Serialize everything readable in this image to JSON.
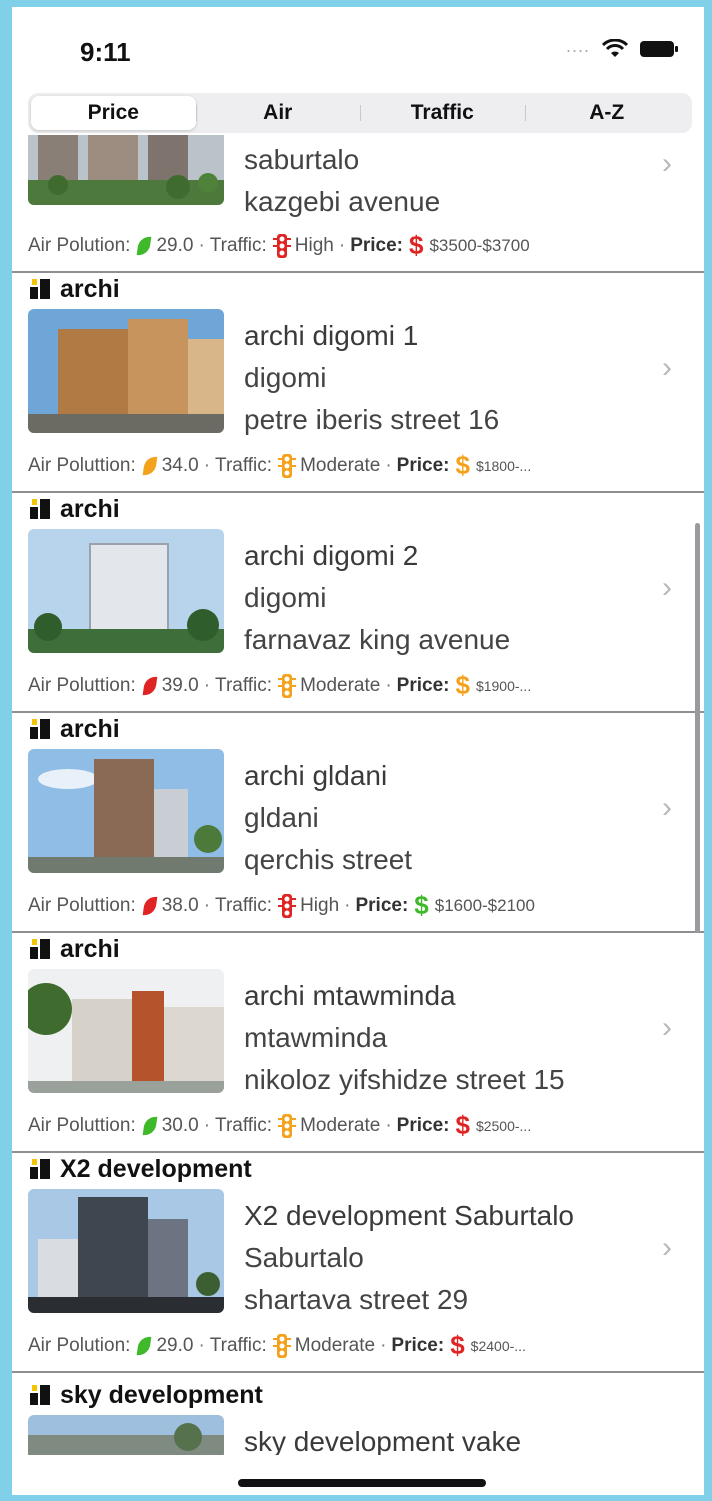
{
  "status_bar": {
    "time": "9:11"
  },
  "colors": {
    "accent_green": "#3fb82a",
    "accent_orange": "#f4a21c",
    "accent_red": "#e02424",
    "divider": "#8f8f93"
  },
  "tabs": [
    {
      "label": "Price",
      "active": true
    },
    {
      "label": "Air",
      "active": false
    },
    {
      "label": "Traffic",
      "active": false
    },
    {
      "label": "A-Z",
      "active": false
    }
  ],
  "meta_labels": {
    "air": "Air Polution:",
    "air_alt": "Air Poluttion:",
    "traffic": "Traffic:",
    "price": "Price:",
    "sep": "·"
  },
  "listings": [
    {
      "developer": "",
      "name": "",
      "district": "saburtalo",
      "address": "kazgebi avenue",
      "air": "29.0",
      "air_label": "Air Polution:",
      "air_color": "#3fb82a",
      "traffic": "High",
      "traffic_icon": "traffic-light-red-icon",
      "traffic_color": "#e02424",
      "price_color": "#e02424",
      "price": "$3500-$3700"
    },
    {
      "developer": "archi",
      "name": "archi digomi 1",
      "district": "digomi",
      "address": "petre iberis street 16",
      "air": "34.0",
      "air_label": "Air Poluttion:",
      "air_color": "#f4a21c",
      "traffic": "Moderate",
      "traffic_icon": "traffic-light-orange-icon",
      "traffic_color": "#f4a21c",
      "price_color": "#f4a21c",
      "price": "$1800-..."
    },
    {
      "developer": "archi",
      "name": "archi digomi 2",
      "district": "digomi",
      "address": "farnavaz king avenue",
      "air": "39.0",
      "air_label": "Air Poluttion:",
      "air_color": "#e02424",
      "traffic": "Moderate",
      "traffic_icon": "traffic-light-orange-icon",
      "traffic_color": "#f4a21c",
      "price_color": "#f4a21c",
      "price": "$1900-..."
    },
    {
      "developer": "archi",
      "name": "archi gldani",
      "district": "gldani",
      "address": "qerchis street",
      "air": "38.0",
      "air_label": "Air Poluttion:",
      "air_color": "#e02424",
      "traffic": "High",
      "traffic_icon": "traffic-light-red-icon",
      "traffic_color": "#e02424",
      "price_color": "#3fb82a",
      "price": "$1600-$2100"
    },
    {
      "developer": "archi",
      "name": "archi mtawminda",
      "district": "mtawminda",
      "address": "nikoloz yifshidze street 15",
      "air": "30.0",
      "air_label": "Air Poluttion:",
      "air_color": "#3fb82a",
      "traffic": "Moderate",
      "traffic_icon": "traffic-light-orange-icon",
      "traffic_color": "#f4a21c",
      "price_color": "#e02424",
      "price": "$2500-..."
    },
    {
      "developer": "X2 development",
      "name": "X2 development Saburtalo",
      "district": "Saburtalo",
      "address": "shartava street 29",
      "air": "29.0",
      "air_label": "Air Polution:",
      "air_color": "#3fb82a",
      "traffic": "Moderate",
      "traffic_icon": "traffic-light-orange-icon",
      "traffic_color": "#f4a21c",
      "price_color": "#e02424",
      "price": "$2400-..."
    },
    {
      "developer": "sky development",
      "name": "sky development vake",
      "district": "",
      "address": "",
      "air": "",
      "traffic": "",
      "price": ""
    }
  ]
}
